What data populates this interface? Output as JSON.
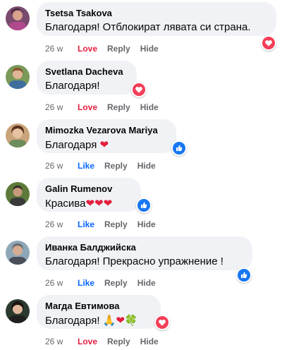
{
  "comments": [
    {
      "author": "Tsetsa Tsakova",
      "text": "Благодаря! Отблокират лявата си страна.",
      "time": "26 w",
      "reaction_label": "Love",
      "reply_label": "Reply",
      "hide_label": "Hide",
      "reaction_icon": "love-icon"
    },
    {
      "author": "Svetlana Dacheva",
      "text": "Благодаря!",
      "time": "26 w",
      "reaction_label": "Love",
      "reply_label": "Reply",
      "hide_label": "Hide",
      "reaction_icon": "love-icon"
    },
    {
      "author": "Mimozka Vezarova Mariya",
      "text": "Благодаря ❤",
      "time": "26 w",
      "reaction_label": "Like",
      "reply_label": "Reply",
      "hide_label": "Hide",
      "reaction_icon": "like-icon"
    },
    {
      "author": "Galin Rumenov",
      "text": "Красива❤❤❤",
      "time": "26 w",
      "reaction_label": "Like",
      "reply_label": "Reply",
      "hide_label": "Hide",
      "reaction_icon": "like-icon"
    },
    {
      "author": "Иванка Балджийска",
      "text": "Благодаря! Прекрасно упражнение !",
      "time": "26 w",
      "reaction_label": "Like",
      "reply_label": "Reply",
      "hide_label": "Hide",
      "reaction_icon": "like-icon"
    },
    {
      "author": "Магда Евтимова",
      "text": "Благодаря! 🙏❤🍀",
      "time": "26 w",
      "reaction_label": "Love",
      "reply_label": "Reply",
      "hide_label": "Hide",
      "reaction_icon": "love-icon"
    }
  ],
  "colors": {
    "love": "#e41e3f",
    "like": "#0866ff",
    "meta": "#65676b",
    "bubble": "#f0f2f5"
  }
}
